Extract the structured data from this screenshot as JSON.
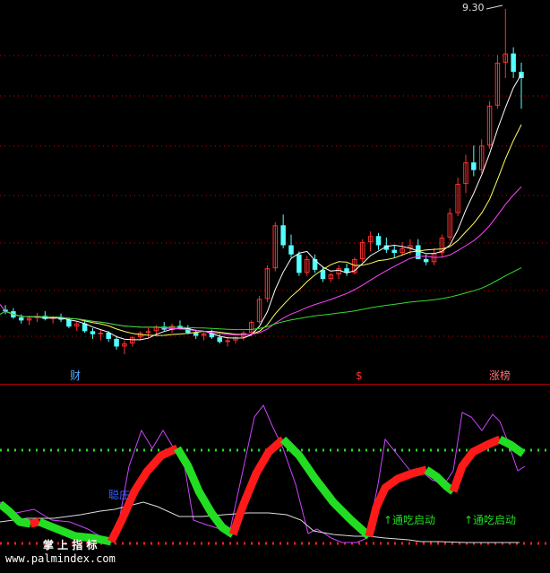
{
  "chart_data": {
    "type": "candlestick",
    "colors": {
      "background": "#000000",
      "up": "#ff3030",
      "down": "#54ffff",
      "ma_short": "#ffffff",
      "ma_mid": "#ffff60",
      "ma_long": "#ff44ff",
      "ma_very_long": "#33dd33",
      "grid": "#cc0000",
      "osc_red": "#ff1a1a",
      "osc_green": "#22dd22",
      "osc_purple": "#cc44ff",
      "osc_white": "#dddddd",
      "level_green": "#22dd22",
      "level_red": "#ff2222"
    },
    "high_label": "9.30",
    "markers": {
      "cai": "财",
      "dollar": "$",
      "zhang": "涨榜"
    },
    "annotations": {
      "zhuang": "聪庄",
      "start1": "↑通吃启动",
      "start2": "↑通吃启动"
    },
    "watermark": {
      "brand": "掌 上 指 标",
      "url": "www.palmindex.com"
    },
    "candles": [
      [
        5.38,
        5.44,
        5.32,
        5.36
      ],
      [
        5.36,
        5.4,
        5.26,
        5.28
      ],
      [
        5.28,
        5.32,
        5.2,
        5.24
      ],
      [
        5.24,
        5.3,
        5.18,
        5.27
      ],
      [
        5.27,
        5.34,
        5.22,
        5.3
      ],
      [
        5.3,
        5.36,
        5.24,
        5.26
      ],
      [
        5.26,
        5.3,
        5.2,
        5.28
      ],
      [
        5.28,
        5.33,
        5.22,
        5.25
      ],
      [
        5.25,
        5.28,
        5.14,
        5.16
      ],
      [
        5.16,
        5.22,
        5.1,
        5.2
      ],
      [
        5.2,
        5.24,
        5.08,
        5.1
      ],
      [
        5.1,
        5.14,
        5.0,
        5.06
      ],
      [
        5.06,
        5.12,
        4.98,
        5.08
      ],
      [
        5.08,
        5.1,
        4.96,
        5.0
      ],
      [
        5.0,
        5.04,
        4.86,
        4.9
      ],
      [
        4.9,
        4.98,
        4.8,
        4.94
      ],
      [
        4.94,
        5.04,
        4.9,
        5.02
      ],
      [
        5.02,
        5.1,
        4.98,
        5.08
      ],
      [
        5.08,
        5.14,
        5.02,
        5.1
      ],
      [
        5.1,
        5.18,
        5.06,
        5.16
      ],
      [
        5.16,
        5.22,
        5.1,
        5.12
      ],
      [
        5.12,
        5.2,
        5.08,
        5.17
      ],
      [
        5.17,
        5.24,
        5.12,
        5.14
      ],
      [
        5.14,
        5.18,
        5.06,
        5.08
      ],
      [
        5.08,
        5.12,
        5.0,
        5.04
      ],
      [
        5.04,
        5.1,
        4.98,
        5.07
      ],
      [
        5.07,
        5.12,
        5.0,
        5.02
      ],
      [
        5.02,
        5.06,
        4.94,
        4.96
      ],
      [
        4.96,
        5.02,
        4.9,
        4.98
      ],
      [
        4.98,
        5.04,
        4.94,
        5.02
      ],
      [
        5.02,
        5.1,
        4.98,
        5.08
      ],
      [
        5.08,
        5.24,
        5.04,
        5.22
      ],
      [
        5.22,
        5.56,
        5.2,
        5.52
      ],
      [
        5.52,
        5.96,
        5.48,
        5.92
      ],
      [
        5.92,
        6.52,
        5.88,
        6.48
      ],
      [
        6.48,
        6.62,
        6.18,
        6.22
      ],
      [
        6.22,
        6.36,
        6.06,
        6.1
      ],
      [
        6.1,
        6.14,
        5.82,
        5.86
      ],
      [
        5.86,
        6.08,
        5.82,
        6.04
      ],
      [
        6.04,
        6.1,
        5.86,
        5.9
      ],
      [
        5.9,
        5.94,
        5.74,
        5.78
      ],
      [
        5.78,
        5.86,
        5.74,
        5.84
      ],
      [
        5.84,
        5.96,
        5.78,
        5.92
      ],
      [
        5.92,
        5.98,
        5.82,
        5.86
      ],
      [
        5.86,
        6.06,
        5.84,
        6.04
      ],
      [
        6.04,
        6.3,
        6.0,
        6.26
      ],
      [
        6.26,
        6.4,
        6.14,
        6.34
      ],
      [
        6.34,
        6.38,
        6.16,
        6.22
      ],
      [
        6.22,
        6.32,
        6.12,
        6.16
      ],
      [
        6.16,
        6.22,
        6.06,
        6.12
      ],
      [
        6.12,
        6.26,
        6.08,
        6.18
      ],
      [
        6.18,
        6.3,
        6.1,
        6.22
      ],
      [
        6.22,
        6.3,
        6.1,
        6.04
      ],
      [
        6.04,
        6.1,
        5.96,
        6.0
      ],
      [
        6.0,
        6.18,
        5.96,
        6.12
      ],
      [
        6.12,
        6.36,
        6.06,
        6.32
      ],
      [
        6.32,
        6.7,
        6.28,
        6.64
      ],
      [
        6.64,
        7.1,
        6.6,
        7.02
      ],
      [
        7.02,
        7.4,
        6.9,
        7.3
      ],
      [
        7.3,
        7.52,
        7.12,
        7.2
      ],
      [
        7.2,
        7.6,
        7.16,
        7.52
      ],
      [
        7.52,
        8.1,
        7.48,
        8.04
      ],
      [
        8.04,
        8.7,
        8.0,
        8.6
      ],
      [
        8.6,
        9.3,
        8.4,
        8.72
      ],
      [
        8.72,
        8.8,
        8.4,
        8.48
      ],
      [
        8.48,
        8.6,
        8.0,
        8.4
      ]
    ],
    "osc_ref_levels": [
      "upper",
      "lower"
    ]
  }
}
